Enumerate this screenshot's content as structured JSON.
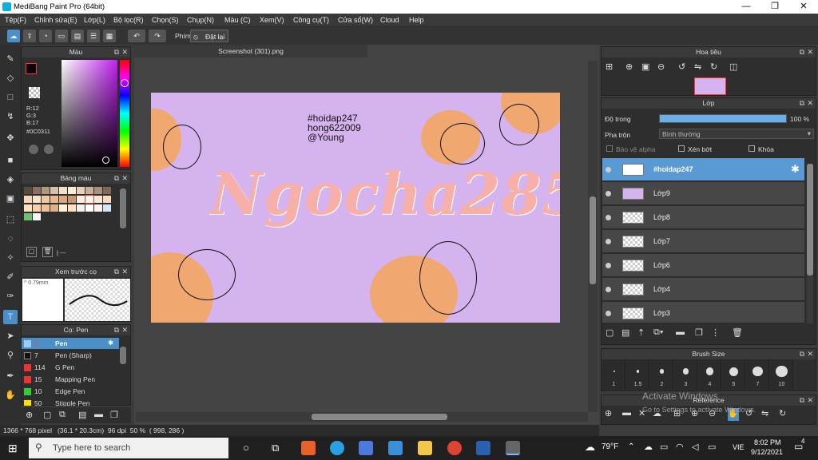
{
  "window": {
    "title": "MediBang Paint Pro (64bit)",
    "minimize": "—",
    "maximize": "❐",
    "close": "✕"
  },
  "menu": [
    "Tệp(F)",
    "Chỉnh sửa(E)",
    "Lớp(L)",
    "Bộ lọc(R)",
    "Chọn(S)",
    "Chụp(N)",
    "Màu (C)",
    "Xem(V)",
    "Công cụ(T)",
    "Cửa sổ(W)",
    "Cloud",
    "Help"
  ],
  "toolbar": {
    "key_label": "Phím",
    "reset_label": "Đặt lại"
  },
  "color_panel": {
    "title": "Màu",
    "r": "R:12",
    "g": "G:3",
    "b": "B:17",
    "hex": "#0C0311"
  },
  "palette_panel": {
    "title": "Bảng màu",
    "more": "| ---"
  },
  "preview_panel": {
    "title": "Xem trước cọ",
    "size": "0.79mm"
  },
  "brush_panel": {
    "title": "Cọ: Pen",
    "brushes": [
      {
        "size": "3",
        "name": "Pen"
      },
      {
        "size": "7",
        "name": "Pen (Sharp)"
      },
      {
        "size": "114",
        "name": "G Pen"
      },
      {
        "size": "15",
        "name": "Mapping Pen"
      },
      {
        "size": "10",
        "name": "Edge Pen"
      },
      {
        "size": "50",
        "name": "Stipple Pen"
      }
    ]
  },
  "canvas": {
    "tab": "Screenshot (301).png",
    "line1": "#hoidap247",
    "line2": "hong622009",
    "line3": "@Young",
    "big_text": "Ngocha285"
  },
  "navigator": {
    "title": "Hoa tiêu"
  },
  "layers_panel": {
    "title": "Lớp",
    "opacity_label": "Độ trong",
    "opacity_value": "100 %",
    "opacity": 1.0,
    "blend_label": "Pha trộn",
    "blend_value": "Bình thường",
    "protect_alpha": "Bảo vệ alpha",
    "clip": "Xén bớt",
    "lock": "Khóa",
    "layers": [
      "#hoidap247",
      "Lớp9",
      "Lớp8",
      "Lớp7",
      "Lớp6",
      "Lớp4",
      "Lớp3"
    ]
  },
  "brush_size": {
    "title": "Brush Size",
    "sizes": [
      "1",
      "1.5",
      "2",
      "3",
      "4",
      "5",
      "7",
      "10"
    ]
  },
  "reference": {
    "title": "Reference"
  },
  "watermark": {
    "line1": "Activate Windows",
    "line2": "Go to Settings to activate Windows."
  },
  "status": {
    "text": "1366 * 768 pixel   (36.1 * 20.3cm)  96 dpi  50 %  ( 998, 286 )"
  },
  "taskbar": {
    "search": "Type here to search",
    "temp": "79°F",
    "lang": "VIE",
    "time": "8:02 PM",
    "date": "9/12/2021",
    "notif": "4"
  },
  "colors": {
    "accent": "#4a8fc8",
    "canvas_bg": "#d4b3ee",
    "blob": "#f0a870"
  }
}
